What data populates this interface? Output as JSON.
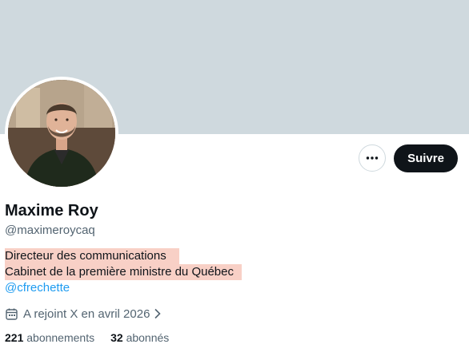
{
  "profile": {
    "name": "Maxime Roy",
    "handle": "@maximeroycaq",
    "bio_line1": "Directeur des communications",
    "bio_line2": "Cabinet de la première ministre du Québec",
    "mention": "@cfrechette",
    "joined": "A rejoint X en avril 2026",
    "following_count": "221",
    "following_label": "abonnements",
    "followers_count": "32",
    "followers_label": "abonnés"
  },
  "actions": {
    "follow_label": "Suivre",
    "more_icon": "more-horizontal-icon"
  },
  "colors": {
    "banner": "#cfd9de",
    "highlight": "#f8d0c6",
    "link": "#1d9bf0",
    "secondary_text": "#536471",
    "primary_text": "#0f1419"
  }
}
